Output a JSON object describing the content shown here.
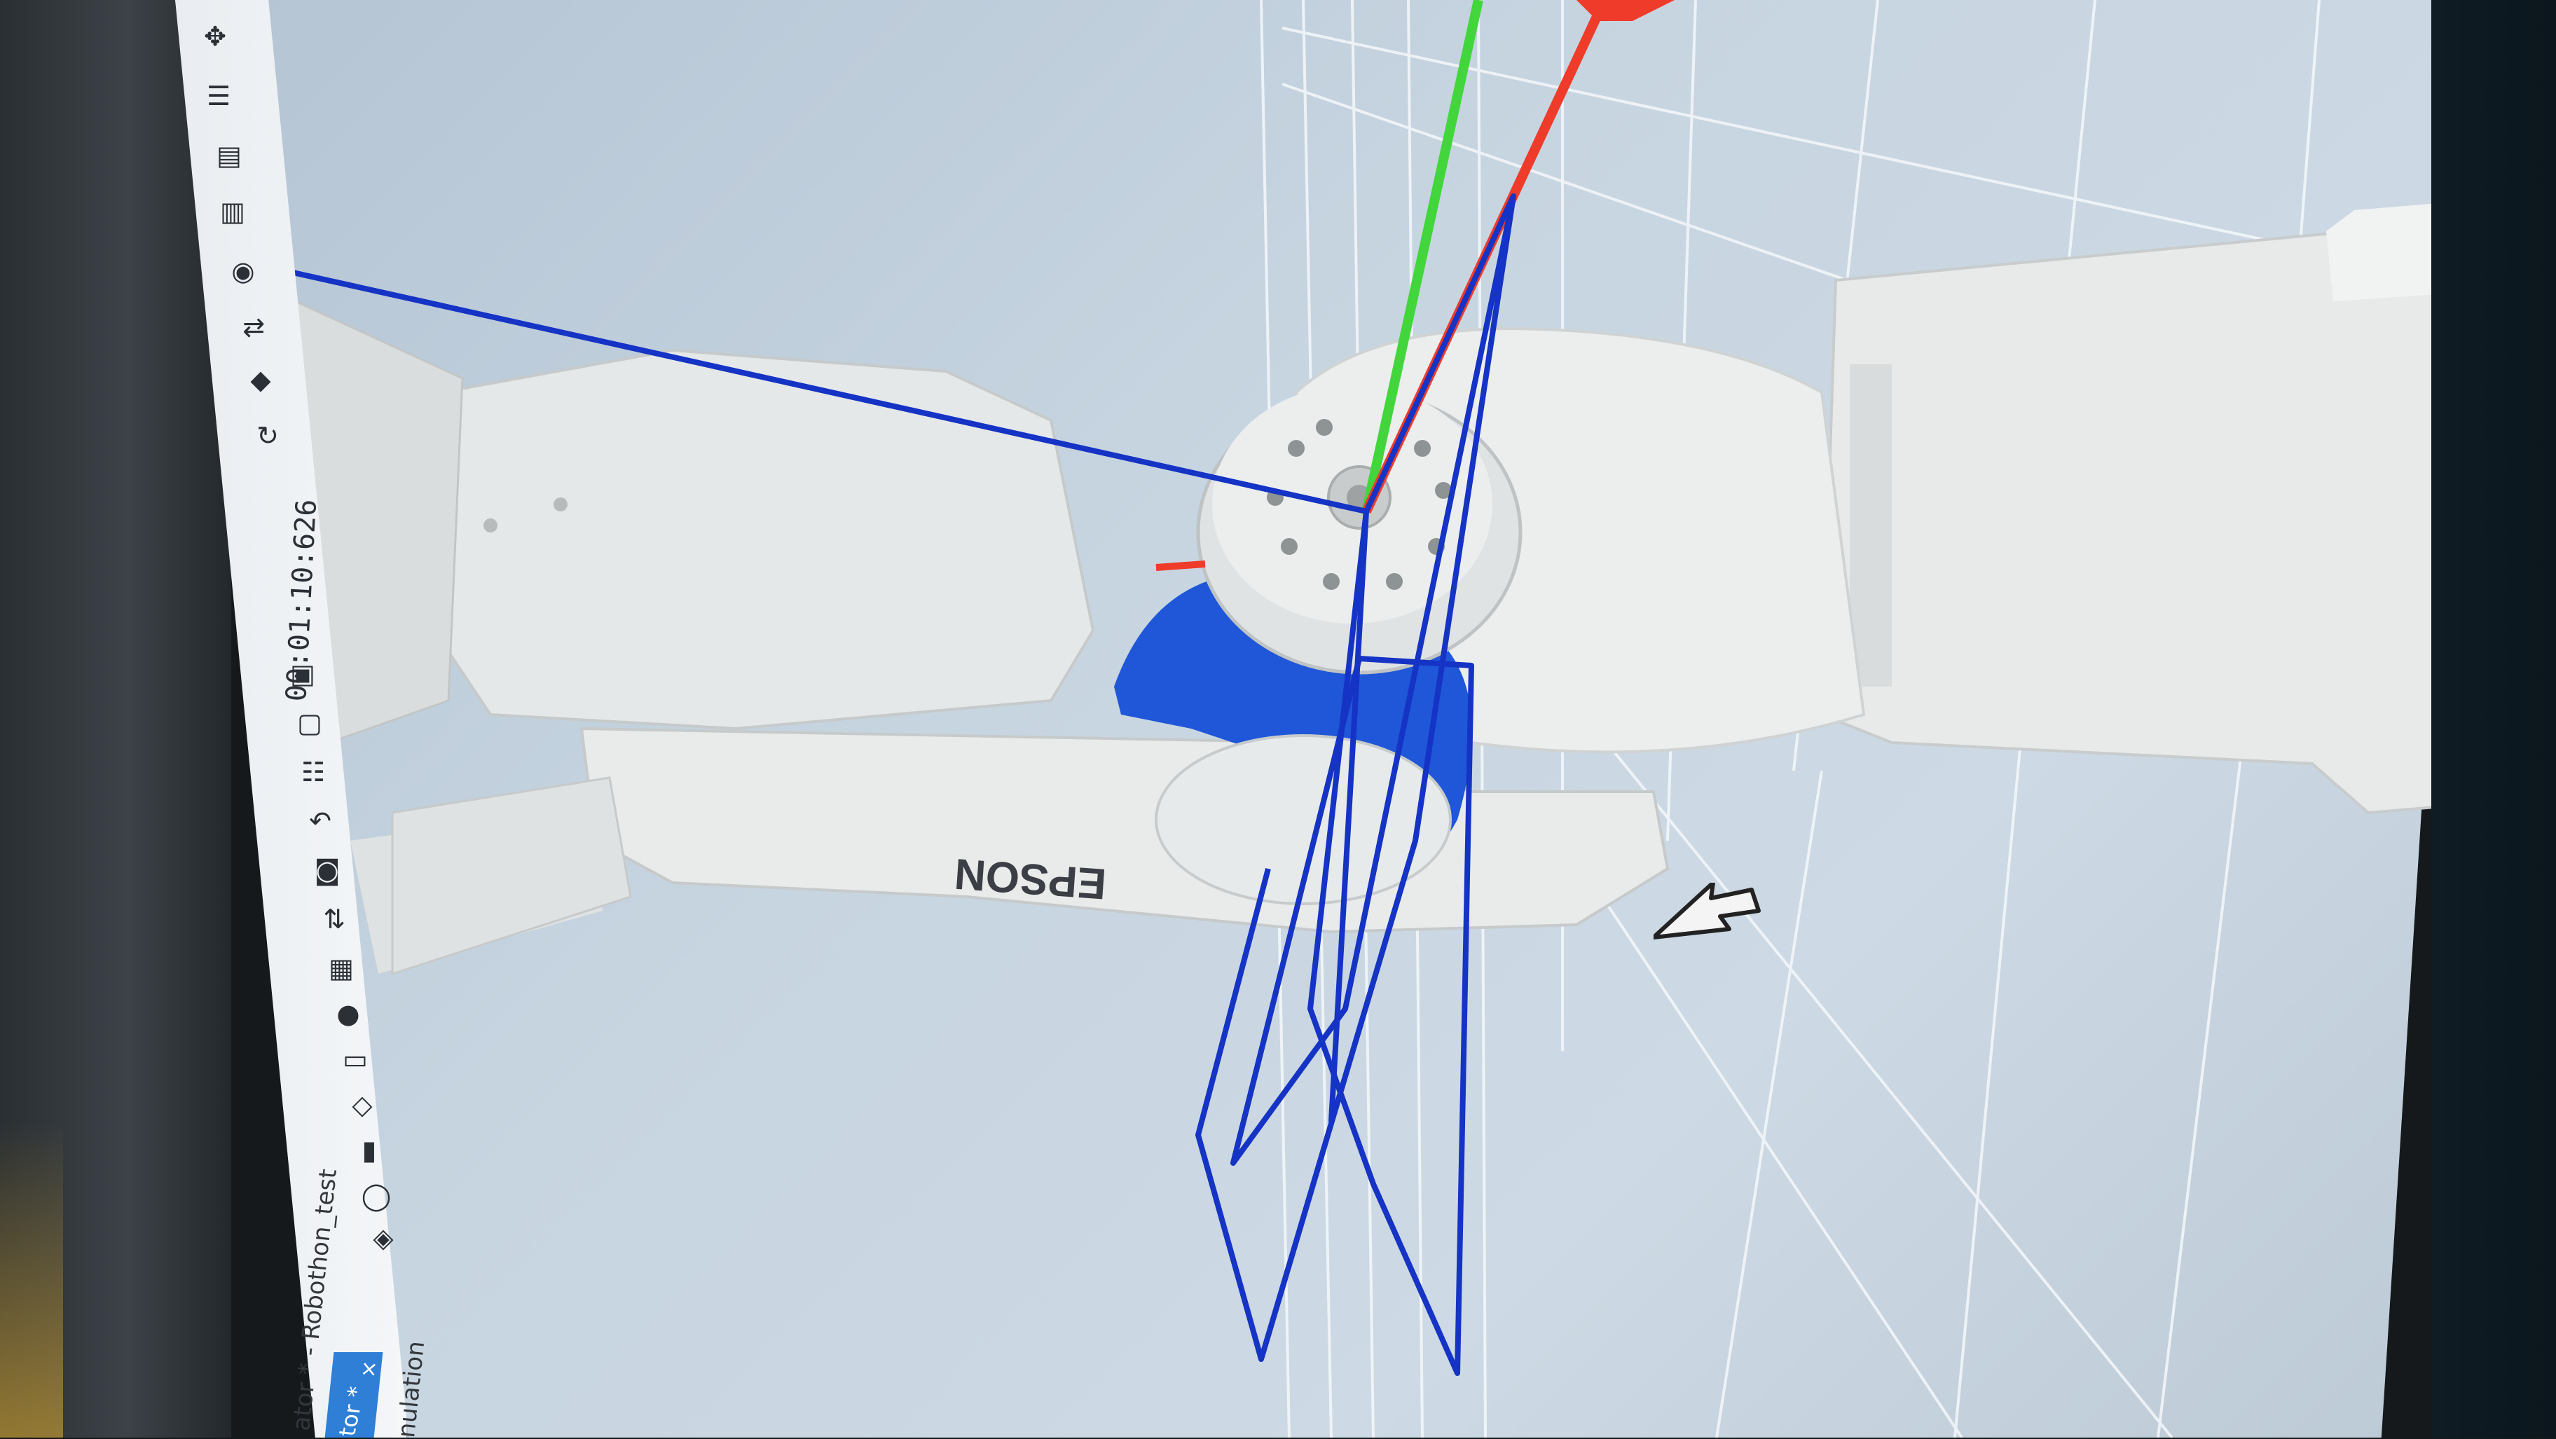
{
  "window": {
    "timer": "00:01:10:626",
    "project_tab": "ator * - Robothon_test",
    "active_tab": "tor *",
    "close_glyph": "×",
    "panel_label": "nulation"
  },
  "robot": {
    "brand_text": "EPSON",
    "body_color": "#eceeee",
    "wrist_color": "#1f57d8",
    "path_color": "#1533c4"
  },
  "axes": {
    "x_color": "#ef3b2a",
    "y_color": "#42d63c",
    "z_color": "#1533c4"
  },
  "toolbar": {
    "icons": [
      "gamepad-icon",
      "sliders-icon",
      "layout-icon",
      "layout-alt-icon",
      "target-icon",
      "swap-icon",
      "eraser-icon",
      "rotate-icon",
      "image-icon",
      "picture-icon",
      "list-icon",
      "undo-icon",
      "camera-icon",
      "step-icon",
      "layers-icon",
      "record-icon",
      "window-icon",
      "diamond-icon",
      "panel-icon",
      "circle-icon",
      "cube-icon"
    ],
    "glyphs": [
      "✥",
      "☰",
      "▤",
      "▥",
      "◉",
      "⇄",
      "◆",
      "↻",
      "▣",
      "▢",
      "☷",
      "↶",
      "◙",
      "⇅",
      "▦",
      "●",
      "▭",
      "◇",
      "▮",
      "◯",
      "◈"
    ]
  }
}
